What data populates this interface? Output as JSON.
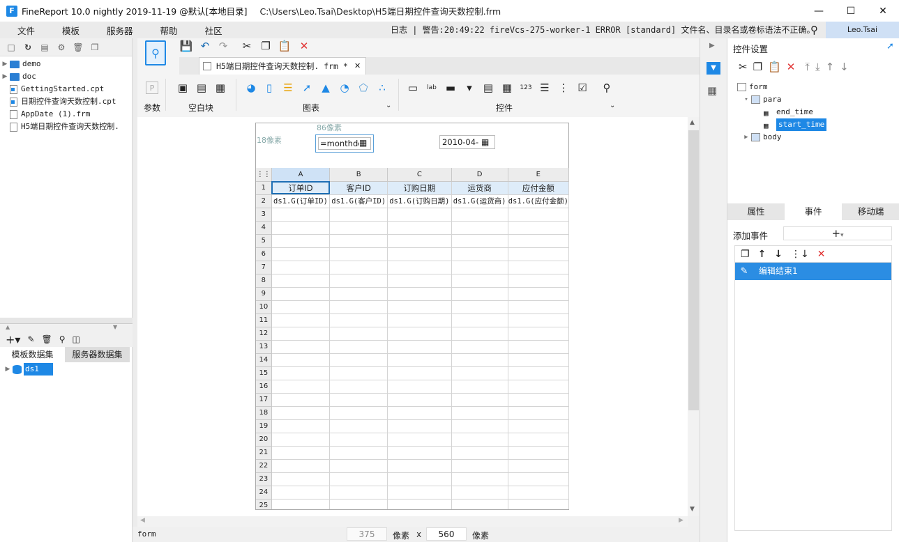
{
  "window": {
    "app_title": "FineReport 10.0 nightly 2019-11-19 @默认[本地目录]",
    "file_path": "C:\\Users\\Leo.Tsai\\Desktop\\H5端日期控件查询天数控制.frm"
  },
  "menu": {
    "items": [
      "文件",
      "模板",
      "服务器",
      "帮助",
      "社区"
    ],
    "log_text": "日志 | 警告:20:49:22 fireVcs-275-worker-1 ERROR [standard] 文件名、目录名或卷标语法不正确。",
    "user": "Leo.Tsai"
  },
  "left_panel": {
    "tree": [
      {
        "label": "demo",
        "type": "folder"
      },
      {
        "label": "doc",
        "type": "folder"
      },
      {
        "label": "GettingStarted.cpt",
        "type": "file"
      },
      {
        "label": "日期控件查询天数控制.cpt",
        "type": "file"
      },
      {
        "label": "AppDate (1).frm",
        "type": "file"
      },
      {
        "label": "H5端日期控件查询天数控制.",
        "type": "file"
      }
    ],
    "dataset_tabs": [
      "模板数据集",
      "服务器数据集"
    ],
    "datasets": [
      "ds1"
    ]
  },
  "ribbon": {
    "tab_label": "H5端日期控件查询天数控制. frm *",
    "groups": [
      "参数",
      "空白块",
      "图表",
      "控件"
    ]
  },
  "form": {
    "label_1": "18像素",
    "label_2": "86像素",
    "start_widget_value": "=monthde",
    "end_widget_value": "2010-04-",
    "columns": [
      "A",
      "B",
      "C",
      "D",
      "E"
    ],
    "header_row": [
      "订单ID",
      "客户ID",
      "订购日期",
      "运货商",
      "应付金额"
    ],
    "data_row": [
      "ds1.G(订单ID)",
      "ds1.G(客户ID)",
      "ds1.G(订购日期)",
      "ds1.G(运货商)",
      "ds1.G(应付金额)"
    ],
    "row_numbers": [
      "1",
      "2",
      "3",
      "4",
      "5",
      "6",
      "7",
      "8",
      "9",
      "10",
      "11",
      "12",
      "13",
      "14",
      "15",
      "16",
      "17",
      "18",
      "19",
      "20",
      "21",
      "22",
      "23",
      "24",
      "25"
    ]
  },
  "status": {
    "mode": "form",
    "width_value": "375",
    "unit1": "像素",
    "times": "x",
    "height_value": "560",
    "unit2": "像素"
  },
  "right_panel": {
    "title": "控件设置",
    "tree": {
      "root": "form",
      "para": "para",
      "children": [
        "end_time",
        "start_time"
      ],
      "body": "body"
    },
    "tabs": [
      "属性",
      "事件",
      "移动端"
    ],
    "add_event_label": "添加事件",
    "events": [
      "编辑结束1"
    ]
  }
}
